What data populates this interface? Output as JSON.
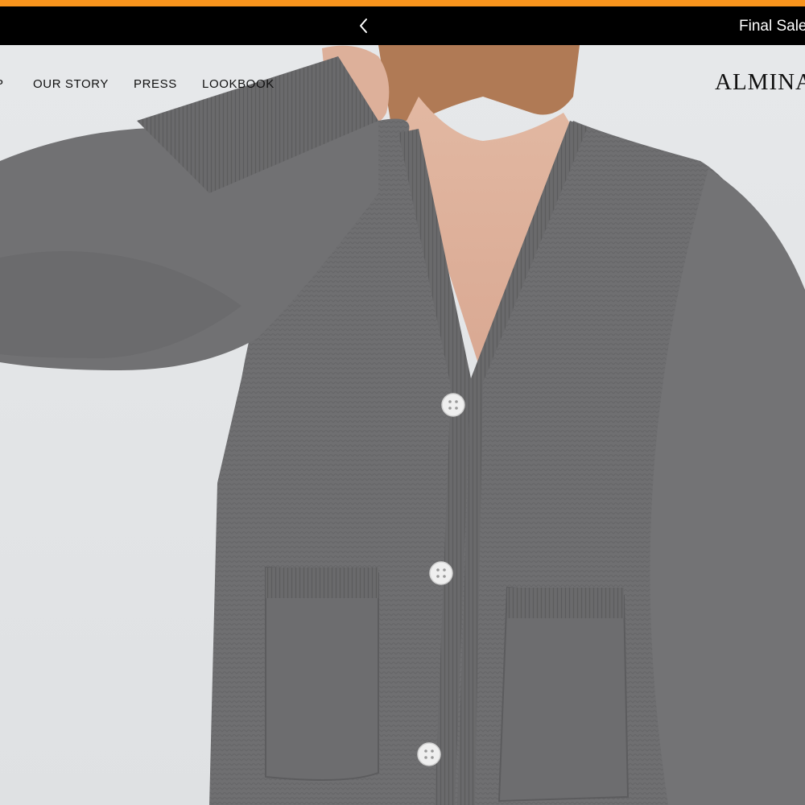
{
  "announcement": {
    "text": "Final Sale",
    "prev_icon": "chevron-left-icon"
  },
  "nav": {
    "items": [
      {
        "label": "P"
      },
      {
        "label": "OUR STORY"
      },
      {
        "label": "PRESS"
      },
      {
        "label": "LOOKBOOK"
      }
    ]
  },
  "brand": {
    "logo": "ALMINA"
  },
  "colors": {
    "top_strip": "#f7941d",
    "announcement_bg": "#000000",
    "sweater": "#6e6e70",
    "background": "#e4e6e8"
  }
}
